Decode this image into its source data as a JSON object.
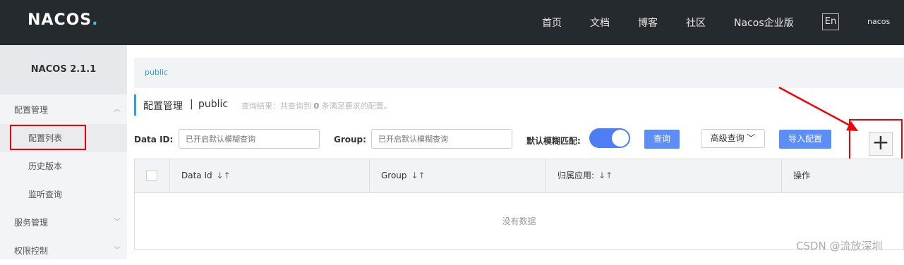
{
  "header": {
    "logo": "NACOS",
    "logo_dot": ".",
    "nav": [
      "首页",
      "文档",
      "博客",
      "社区",
      "Nacos企业版"
    ],
    "lang": "En",
    "user": "nacos"
  },
  "sidebar": {
    "version": "NACOS 2.1.1",
    "items": [
      {
        "label": "配置管理",
        "group": true
      },
      {
        "label": "配置列表",
        "active": true
      },
      {
        "label": "历史版本"
      },
      {
        "label": "监听查询"
      },
      {
        "label": "服务管理",
        "group": true
      },
      {
        "label": "权限控制",
        "group": true
      }
    ]
  },
  "namespace_tab": "public",
  "page": {
    "title": "配置管理",
    "separator": "|",
    "namespace": "public",
    "result_prefix": "查询结果：共查询到",
    "result_count": "0",
    "result_suffix": "条满足要求的配置。"
  },
  "filters": {
    "dataid_label": "Data ID:",
    "dataid_placeholder": "已开启默认模糊查询",
    "group_label": "Group:",
    "group_placeholder": "已开启默认模糊查询",
    "fuzzy_label": "默认模糊匹配:",
    "fuzzy_enabled": true,
    "query_button": "查询",
    "advanced_button": "高级查询",
    "import_button": "导入配置",
    "add_button": "+"
  },
  "table": {
    "columns": [
      "Data Id",
      "Group",
      "归属应用:",
      "操作"
    ],
    "sort_icon": "↓↑",
    "empty": "没有数据"
  },
  "watermark": "CSDN @流放深圳",
  "annotation_color": "#e00000"
}
